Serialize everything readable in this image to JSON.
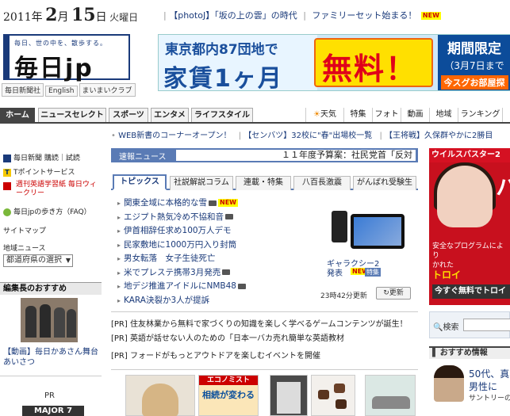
{
  "date": {
    "year": "2011",
    "year_suffix": "年",
    "month": "2",
    "month_suffix": "月",
    "day": "15",
    "day_suffix": "日",
    "weekday": "火曜日"
  },
  "top_news": [
    {
      "text": "【photoJ】「坂の上の雲」の時代"
    },
    {
      "text": "ファミリーセット始まる！",
      "badge": "NEW"
    }
  ],
  "logo": {
    "tagline": "毎日、世の中を、散歩する。",
    "text": "毎日jp"
  },
  "sub_links": [
    "毎日新聞社",
    "English",
    "まいまいクラブ"
  ],
  "banner": {
    "line1": "東京都内87団地で",
    "line2": "家賃1ヶ月",
    "big": "無料！",
    "right1": "期間限定",
    "right2": "（3月7日まで",
    "right3": "今スグお部屋探"
  },
  "nav": {
    "tabs": [
      "ホーム",
      "ニュースセレクト",
      "スポーツ",
      "エンタメ",
      "ライフスタイル"
    ],
    "tabs2": [
      "天気",
      "特集",
      "フォト",
      "動画",
      "地域",
      "ランキング"
    ]
  },
  "sub_news": [
    "WEB新書のコーナーオープン！",
    "【センバツ】32校に\"春\"出場校一覧",
    "【王将戦】久保群やかに2勝目"
  ],
  "sidebar": {
    "items": [
      {
        "label": "毎日新聞 購読｜試読"
      },
      {
        "label": "Tポイントサービス"
      },
      {
        "label": "週刊英語学習紙 毎日ウィークリー"
      },
      {
        "label": "毎日jpの歩き方（FAQ）"
      },
      {
        "label": "サイトマップ"
      }
    ],
    "local_label": "地域ニュース",
    "select_value": "都道府県の選択",
    "editor_header": "編集長のおすすめ",
    "editor_caption": "【動画】毎日かあさん舞台あいさつ",
    "pr_label": "PR",
    "pr_text": "MAJOR 7"
  },
  "ticker": {
    "label": "速報ニュース",
    "text": "１１年度予算案：社民党首「反対"
  },
  "topic_tabs": [
    "トピックス",
    "社説解説コラム",
    "連載・特集",
    "八百長激震",
    "がんばれ受験生"
  ],
  "topics": [
    {
      "text": "関東全域に本格的な雪",
      "cam": true,
      "new": "NEW"
    },
    {
      "text": "エジプト熱気冷め不協和音",
      "cam": true
    },
    {
      "text": "伊首相辞任求め100万人デモ"
    },
    {
      "text": "民家敷地に1000万円入り封筒"
    },
    {
      "text": "男女転落　女子生徒死亡"
    },
    {
      "text": "米でプレステ携帯3月発売",
      "cam": true
    },
    {
      "text": "地デジ推進アイドルにNMB48",
      "cam": true
    },
    {
      "text": "KARA決裂か3人が提訴"
    }
  ],
  "promo": {
    "title": "ギャラクシー2",
    "sub": "発表",
    "badge1": "NEW",
    "badge2": "特集",
    "updated": "23時42分更新",
    "refresh": "更新"
  },
  "pr": [
    "[PR] 住友林業から無料で家づくりの知識を楽しく学べるゲームコンテンツが誕生！",
    "[PR] 英語が話せない人のための「日本一バカ売れ簡単な英語教材",
    "[PR] フォードがもっとアウトドアを楽しむイベントを開催"
  ],
  "thumbs": {
    "mag_title": "エコノミスト",
    "mag_text": "相続が変わる"
  },
  "right_ad": {
    "top": "ウイルスバスター2",
    "mid1": "安全なプログラムにより",
    "mid2": "かれた",
    "mid3": "トロイ",
    "btn": "今すぐ無料でトロイ"
  },
  "right_search": {
    "label": "検索"
  },
  "right_rec": {
    "header": "おすすめ情報",
    "line1": "50代、真",
    "line2": "男性に",
    "line3": "サントリーの"
  },
  "colors": {
    "nav_active": "#444444",
    "accent_blue": "#5a7bb5",
    "link_blue": "#1a3a7a",
    "new_badge": "#ffff00",
    "ad_red": "#c8101e"
  }
}
